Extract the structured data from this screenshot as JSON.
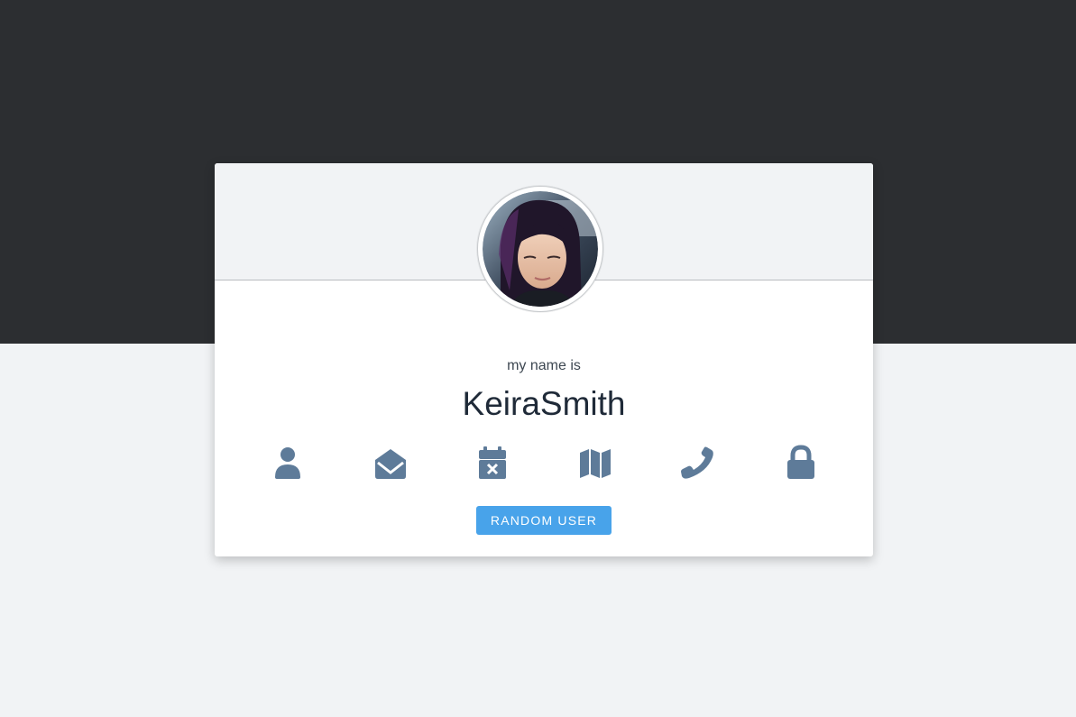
{
  "card": {
    "label": "my name is",
    "value": "KeiraSmith",
    "button_label": "RANDOM USER"
  },
  "icons": [
    {
      "name": "user-icon"
    },
    {
      "name": "envelope-open-icon"
    },
    {
      "name": "calendar-times-icon"
    },
    {
      "name": "map-icon"
    },
    {
      "name": "phone-icon"
    },
    {
      "name": "lock-icon"
    }
  ],
  "colors": {
    "top_band": "#2c2e31",
    "background": "#f1f3f5",
    "icon": "#5e7b99",
    "button": "#48a3ea",
    "name_text": "#1f2a38"
  }
}
